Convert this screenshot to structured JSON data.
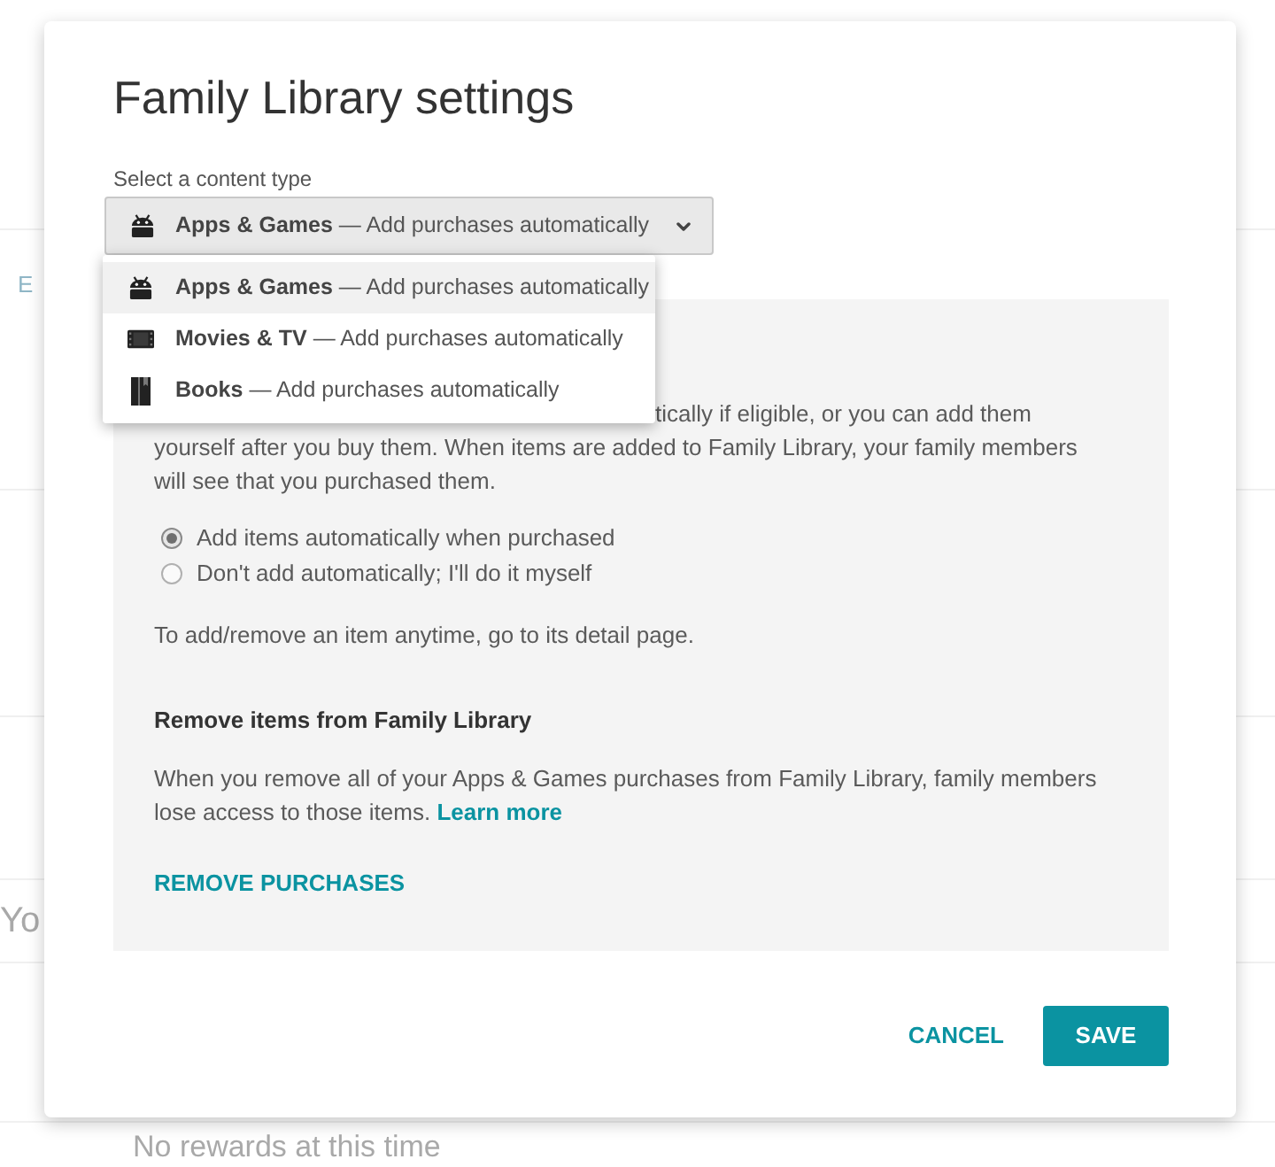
{
  "background_page": {
    "fragment_1": "E",
    "fragment_2": "Yo",
    "empty_message": "No rewards at this time"
  },
  "dialog": {
    "title": "Family Library settings",
    "content_type_label": "Select a content type",
    "select": {
      "kind": "apps",
      "label": "Apps & Games",
      "detail": "— Add purchases automatically",
      "expanded": true
    },
    "menu": [
      {
        "kind": "apps",
        "label": "Apps & Games",
        "detail": "— Add purchases automatically",
        "selected": true
      },
      {
        "kind": "movies",
        "label": "Movies & TV",
        "detail": "— Add purchases automatically",
        "selected": false
      },
      {
        "kind": "books",
        "label": "Books",
        "detail": "— Add purchases automatically",
        "selected": false
      }
    ],
    "panel": {
      "intro": "tically if eligible, or you can add them yourself after you buy them. When items are added to Family Library, your family members will see that you purchased them.",
      "options": [
        {
          "label": "Add items automatically when purchased",
          "selected": true
        },
        {
          "label": "Don't add automatically; I'll do it myself",
          "selected": false
        }
      ],
      "note": "To add/remove an item anytime, go to its detail page.",
      "remove_heading": "Remove items from Family Library",
      "remove_text": "When you remove all of your Apps & Games purchases from Family Library, family members lose access to those items.",
      "learn_more": "Learn more",
      "remove_button": "REMOVE PURCHASES"
    },
    "buttons": [
      {
        "kind": "text",
        "label": "CANCEL"
      },
      {
        "kind": "filled",
        "label": "SAVE"
      }
    ]
  }
}
